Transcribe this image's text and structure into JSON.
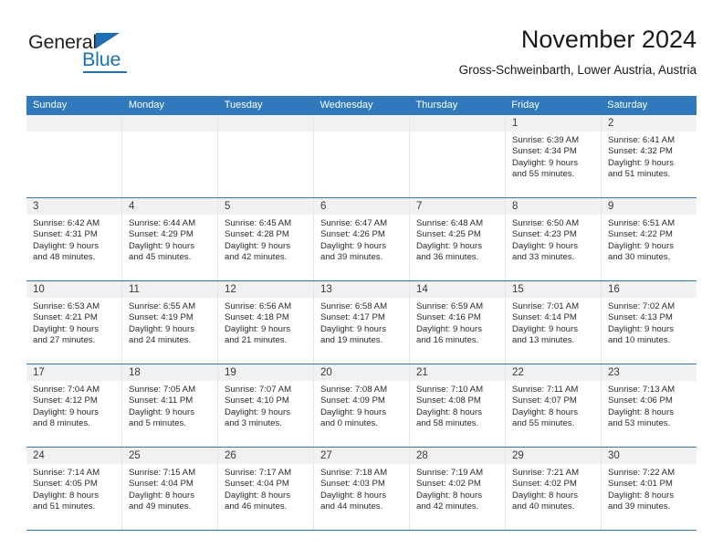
{
  "brand": {
    "name_part1": "General",
    "name_part2": "Blue",
    "triangle_color": "#1c6fb5",
    "blue_color": "#1c72b8"
  },
  "header": {
    "title": "November 2024",
    "subtitle": "Gross-Schweinbarth, Lower Austria, Austria"
  },
  "theme": {
    "header_blue": "#3079bd",
    "day_band_gray": "#f1f1f1",
    "grid_line": "#e6e6e6"
  },
  "weekdays": [
    "Sunday",
    "Monday",
    "Tuesday",
    "Wednesday",
    "Thursday",
    "Friday",
    "Saturday"
  ],
  "weeks": [
    [
      {
        "day": "",
        "empty": true,
        "sunrise": "",
        "sunset": "",
        "daylight_line1": "",
        "daylight_line2": ""
      },
      {
        "day": "",
        "empty": true,
        "sunrise": "",
        "sunset": "",
        "daylight_line1": "",
        "daylight_line2": ""
      },
      {
        "day": "",
        "empty": true,
        "sunrise": "",
        "sunset": "",
        "daylight_line1": "",
        "daylight_line2": ""
      },
      {
        "day": "",
        "empty": true,
        "sunrise": "",
        "sunset": "",
        "daylight_line1": "",
        "daylight_line2": ""
      },
      {
        "day": "",
        "empty": true,
        "sunrise": "",
        "sunset": "",
        "daylight_line1": "",
        "daylight_line2": ""
      },
      {
        "day": "1",
        "sunrise": "Sunrise: 6:39 AM",
        "sunset": "Sunset: 4:34 PM",
        "daylight_line1": "Daylight: 9 hours",
        "daylight_line2": "and 55 minutes."
      },
      {
        "day": "2",
        "sunrise": "Sunrise: 6:41 AM",
        "sunset": "Sunset: 4:32 PM",
        "daylight_line1": "Daylight: 9 hours",
        "daylight_line2": "and 51 minutes."
      }
    ],
    [
      {
        "day": "3",
        "sunrise": "Sunrise: 6:42 AM",
        "sunset": "Sunset: 4:31 PM",
        "daylight_line1": "Daylight: 9 hours",
        "daylight_line2": "and 48 minutes."
      },
      {
        "day": "4",
        "sunrise": "Sunrise: 6:44 AM",
        "sunset": "Sunset: 4:29 PM",
        "daylight_line1": "Daylight: 9 hours",
        "daylight_line2": "and 45 minutes."
      },
      {
        "day": "5",
        "sunrise": "Sunrise: 6:45 AM",
        "sunset": "Sunset: 4:28 PM",
        "daylight_line1": "Daylight: 9 hours",
        "daylight_line2": "and 42 minutes."
      },
      {
        "day": "6",
        "sunrise": "Sunrise: 6:47 AM",
        "sunset": "Sunset: 4:26 PM",
        "daylight_line1": "Daylight: 9 hours",
        "daylight_line2": "and 39 minutes."
      },
      {
        "day": "7",
        "sunrise": "Sunrise: 6:48 AM",
        "sunset": "Sunset: 4:25 PM",
        "daylight_line1": "Daylight: 9 hours",
        "daylight_line2": "and 36 minutes."
      },
      {
        "day": "8",
        "sunrise": "Sunrise: 6:50 AM",
        "sunset": "Sunset: 4:23 PM",
        "daylight_line1": "Daylight: 9 hours",
        "daylight_line2": "and 33 minutes."
      },
      {
        "day": "9",
        "sunrise": "Sunrise: 6:51 AM",
        "sunset": "Sunset: 4:22 PM",
        "daylight_line1": "Daylight: 9 hours",
        "daylight_line2": "and 30 minutes."
      }
    ],
    [
      {
        "day": "10",
        "sunrise": "Sunrise: 6:53 AM",
        "sunset": "Sunset: 4:21 PM",
        "daylight_line1": "Daylight: 9 hours",
        "daylight_line2": "and 27 minutes."
      },
      {
        "day": "11",
        "sunrise": "Sunrise: 6:55 AM",
        "sunset": "Sunset: 4:19 PM",
        "daylight_line1": "Daylight: 9 hours",
        "daylight_line2": "and 24 minutes."
      },
      {
        "day": "12",
        "sunrise": "Sunrise: 6:56 AM",
        "sunset": "Sunset: 4:18 PM",
        "daylight_line1": "Daylight: 9 hours",
        "daylight_line2": "and 21 minutes."
      },
      {
        "day": "13",
        "sunrise": "Sunrise: 6:58 AM",
        "sunset": "Sunset: 4:17 PM",
        "daylight_line1": "Daylight: 9 hours",
        "daylight_line2": "and 19 minutes."
      },
      {
        "day": "14",
        "sunrise": "Sunrise: 6:59 AM",
        "sunset": "Sunset: 4:16 PM",
        "daylight_line1": "Daylight: 9 hours",
        "daylight_line2": "and 16 minutes."
      },
      {
        "day": "15",
        "sunrise": "Sunrise: 7:01 AM",
        "sunset": "Sunset: 4:14 PM",
        "daylight_line1": "Daylight: 9 hours",
        "daylight_line2": "and 13 minutes."
      },
      {
        "day": "16",
        "sunrise": "Sunrise: 7:02 AM",
        "sunset": "Sunset: 4:13 PM",
        "daylight_line1": "Daylight: 9 hours",
        "daylight_line2": "and 10 minutes."
      }
    ],
    [
      {
        "day": "17",
        "sunrise": "Sunrise: 7:04 AM",
        "sunset": "Sunset: 4:12 PM",
        "daylight_line1": "Daylight: 9 hours",
        "daylight_line2": "and 8 minutes."
      },
      {
        "day": "18",
        "sunrise": "Sunrise: 7:05 AM",
        "sunset": "Sunset: 4:11 PM",
        "daylight_line1": "Daylight: 9 hours",
        "daylight_line2": "and 5 minutes."
      },
      {
        "day": "19",
        "sunrise": "Sunrise: 7:07 AM",
        "sunset": "Sunset: 4:10 PM",
        "daylight_line1": "Daylight: 9 hours",
        "daylight_line2": "and 3 minutes."
      },
      {
        "day": "20",
        "sunrise": "Sunrise: 7:08 AM",
        "sunset": "Sunset: 4:09 PM",
        "daylight_line1": "Daylight: 9 hours",
        "daylight_line2": "and 0 minutes."
      },
      {
        "day": "21",
        "sunrise": "Sunrise: 7:10 AM",
        "sunset": "Sunset: 4:08 PM",
        "daylight_line1": "Daylight: 8 hours",
        "daylight_line2": "and 58 minutes."
      },
      {
        "day": "22",
        "sunrise": "Sunrise: 7:11 AM",
        "sunset": "Sunset: 4:07 PM",
        "daylight_line1": "Daylight: 8 hours",
        "daylight_line2": "and 55 minutes."
      },
      {
        "day": "23",
        "sunrise": "Sunrise: 7:13 AM",
        "sunset": "Sunset: 4:06 PM",
        "daylight_line1": "Daylight: 8 hours",
        "daylight_line2": "and 53 minutes."
      }
    ],
    [
      {
        "day": "24",
        "sunrise": "Sunrise: 7:14 AM",
        "sunset": "Sunset: 4:05 PM",
        "daylight_line1": "Daylight: 8 hours",
        "daylight_line2": "and 51 minutes."
      },
      {
        "day": "25",
        "sunrise": "Sunrise: 7:15 AM",
        "sunset": "Sunset: 4:04 PM",
        "daylight_line1": "Daylight: 8 hours",
        "daylight_line2": "and 49 minutes."
      },
      {
        "day": "26",
        "sunrise": "Sunrise: 7:17 AM",
        "sunset": "Sunset: 4:04 PM",
        "daylight_line1": "Daylight: 8 hours",
        "daylight_line2": "and 46 minutes."
      },
      {
        "day": "27",
        "sunrise": "Sunrise: 7:18 AM",
        "sunset": "Sunset: 4:03 PM",
        "daylight_line1": "Daylight: 8 hours",
        "daylight_line2": "and 44 minutes."
      },
      {
        "day": "28",
        "sunrise": "Sunrise: 7:19 AM",
        "sunset": "Sunset: 4:02 PM",
        "daylight_line1": "Daylight: 8 hours",
        "daylight_line2": "and 42 minutes."
      },
      {
        "day": "29",
        "sunrise": "Sunrise: 7:21 AM",
        "sunset": "Sunset: 4:02 PM",
        "daylight_line1": "Daylight: 8 hours",
        "daylight_line2": "and 40 minutes."
      },
      {
        "day": "30",
        "sunrise": "Sunrise: 7:22 AM",
        "sunset": "Sunset: 4:01 PM",
        "daylight_line1": "Daylight: 8 hours",
        "daylight_line2": "and 39 minutes."
      }
    ]
  ]
}
